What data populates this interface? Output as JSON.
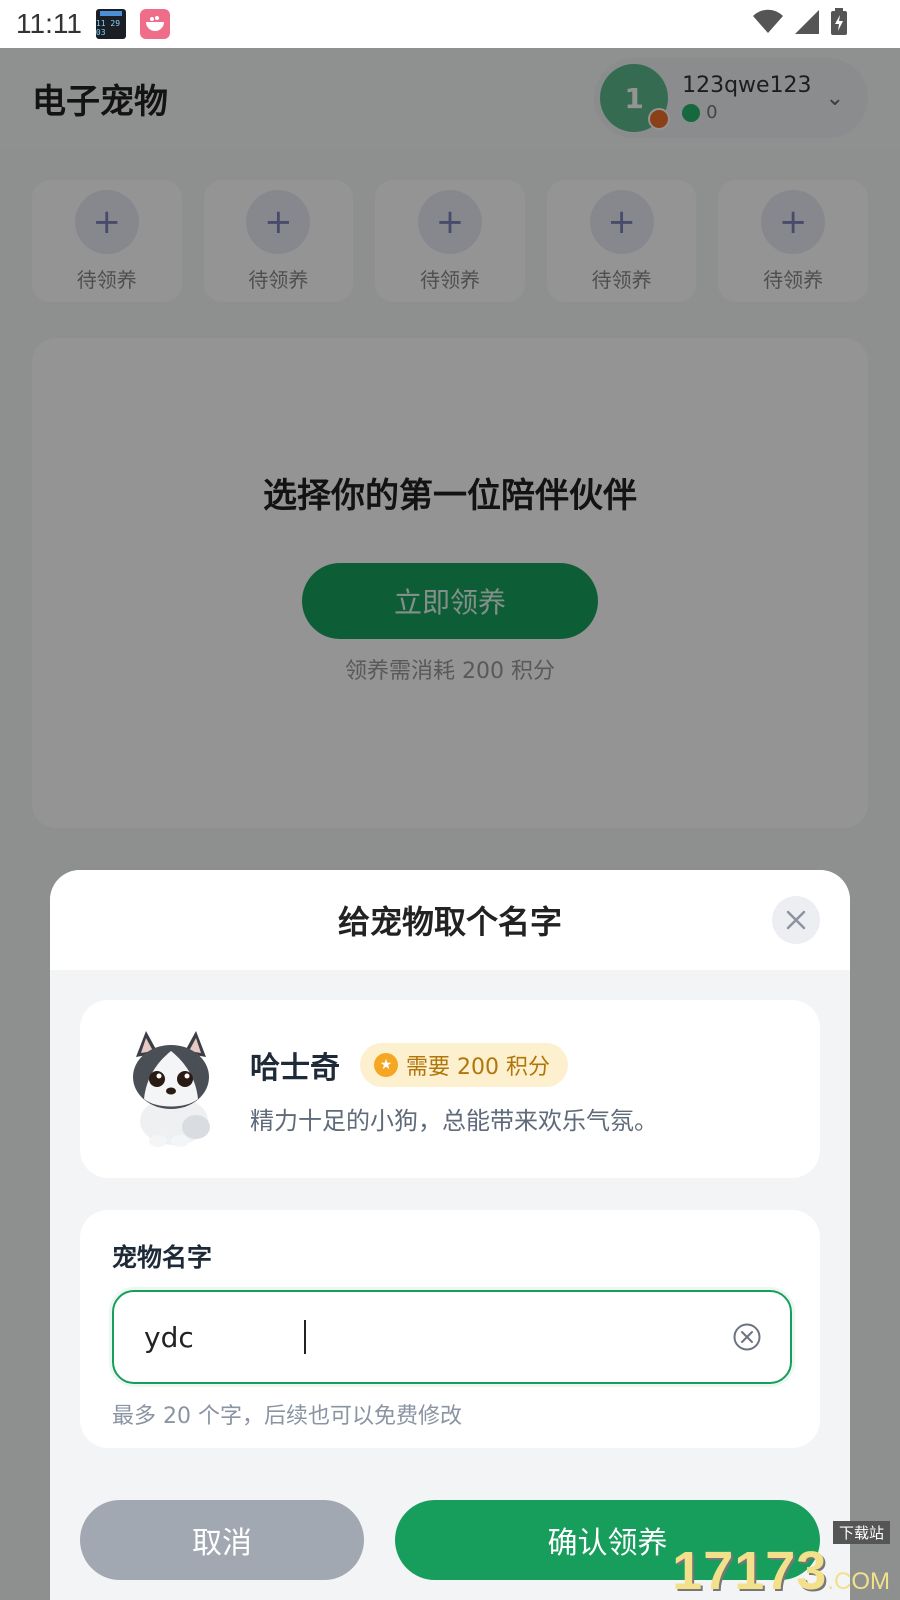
{
  "status_bar": {
    "time": "11:11",
    "app1_icon": "clock-widget-icon",
    "app1_text": "11 29 03",
    "app2_icon": "rice-bowl-app-icon",
    "wifi_icon": "wifi-icon",
    "signal_icon": "signal-icon",
    "battery_icon": "battery-charging-icon"
  },
  "header": {
    "title": "电子宠物",
    "user": {
      "avatar_letter": "1",
      "name": "123qwe123",
      "status_value": "0"
    }
  },
  "slots": [
    {
      "label": "待领养"
    },
    {
      "label": "待领养"
    },
    {
      "label": "待领养"
    },
    {
      "label": "待领养"
    },
    {
      "label": "待领养"
    }
  ],
  "hero": {
    "title": "选择你的第一位陪伴伙伴",
    "button_label": "立即领养",
    "note": "领养需消耗 200 积分"
  },
  "dialog": {
    "title": "给宠物取个名字",
    "pet": {
      "name": "哈士奇",
      "cost_label": "需要 200 积分",
      "description": "精力十足的小狗，总能带来欢乐气氛。"
    },
    "name_field": {
      "label": "宠物名字",
      "value": "ydc",
      "hint": "最多 20 个字，后续也可以免费修改"
    },
    "cancel_label": "取消",
    "confirm_label": "确认领养"
  },
  "watermark": {
    "top": "下载站",
    "main": "17173",
    "suffix": ".COM"
  },
  "colors": {
    "accent": "#179d5c",
    "cancel": "#a1a8b1",
    "badge_bg": "#fdf0cf",
    "badge_text": "#b0760a"
  }
}
